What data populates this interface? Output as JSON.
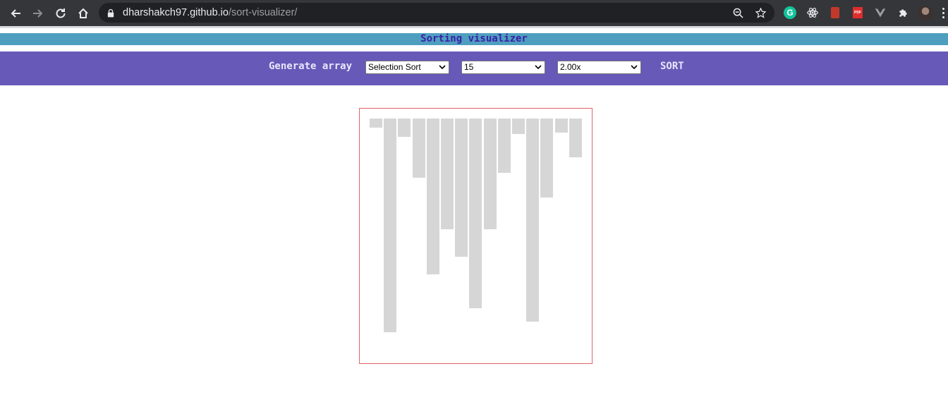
{
  "browser": {
    "url_host": "dharshakch97.github.io",
    "url_path": "/sort-visualizer/"
  },
  "page": {
    "title": "Sorting visualizer",
    "generate_label": "Generate array",
    "sort_label": "SORT",
    "algorithm": "Selection Sort",
    "array_size": "15",
    "speed": "2.00x",
    "colors": {
      "title_bg": "#4e9fbf",
      "controls_bg": "#6659b8",
      "bar": "#d6d6d6",
      "border": "#e06464"
    }
  },
  "array_values": [
    13,
    303,
    26,
    84,
    221,
    157,
    196,
    269,
    157,
    77,
    22,
    288,
    112,
    20,
    55
  ]
}
